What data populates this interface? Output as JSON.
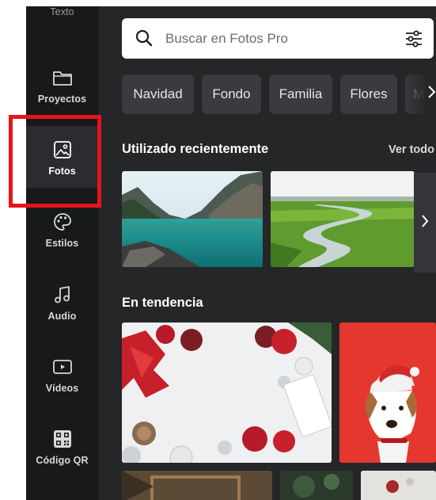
{
  "sidebar": {
    "items": [
      {
        "label": "Texto",
        "icon": "text-icon"
      },
      {
        "label": "Proyectos",
        "icon": "folder-icon"
      },
      {
        "label": "Fotos",
        "icon": "image-icon",
        "active": true
      },
      {
        "label": "Estilos",
        "icon": "palette-icon"
      },
      {
        "label": "Audio",
        "icon": "music-note-icon"
      },
      {
        "label": "Vídeos",
        "icon": "video-icon"
      },
      {
        "label": "Código QR",
        "icon": "qr-code-icon"
      }
    ]
  },
  "search": {
    "placeholder": "Buscar en Fotos Pro"
  },
  "chips": [
    "Navidad",
    "Fondo",
    "Familia",
    "Flores",
    "M"
  ],
  "recent": {
    "title": "Utilizado recientemente",
    "see_all": "Ver todo"
  },
  "trending": {
    "title": "En tendencia"
  },
  "colors": {
    "sidebar_bg": "#18191b",
    "panel_bg": "#252628",
    "chip_bg": "#3a3b3e",
    "highlight": "#e8131a"
  }
}
